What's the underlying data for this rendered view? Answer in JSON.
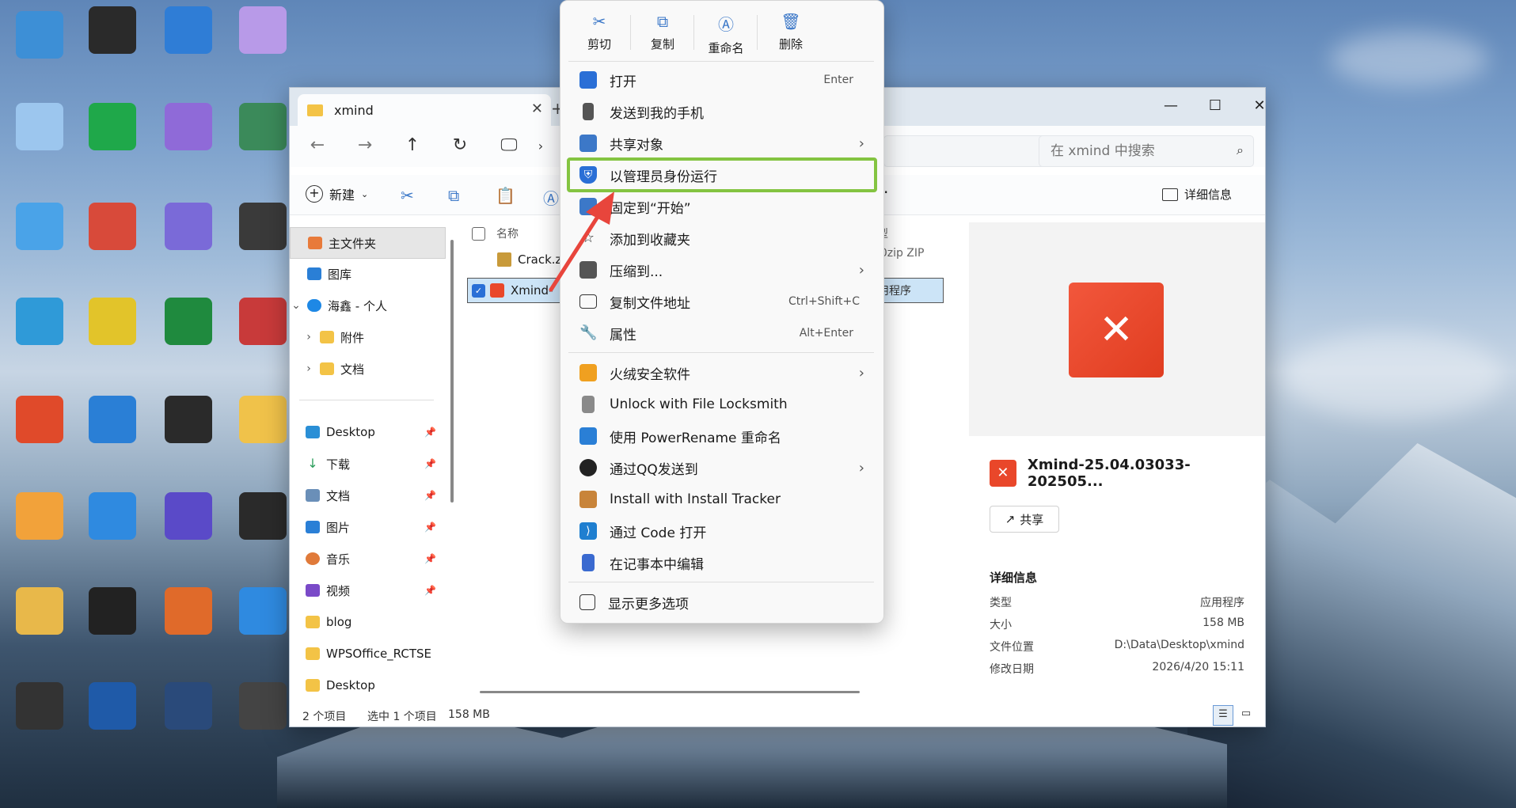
{
  "explorer": {
    "tab_title": "xmind",
    "search_placeholder": "在 xmind 中搜索",
    "toolbar": {
      "new_label": "新建",
      "details_label": "详细信息"
    },
    "sidebar": {
      "items": [
        {
          "label": "主文件夹",
          "icon": "home-icon"
        },
        {
          "label": "图库",
          "icon": "gallery-icon"
        },
        {
          "label": "海鑫 - 个人",
          "icon": "onedrive-icon"
        },
        {
          "label": "附件",
          "icon": "folder-icon"
        },
        {
          "label": "文档",
          "icon": "folder-icon"
        }
      ],
      "quick_access": [
        {
          "label": "Desktop",
          "icon": "desktop-icon"
        },
        {
          "label": "下载",
          "icon": "download-icon"
        },
        {
          "label": "文档",
          "icon": "documents-icon"
        },
        {
          "label": "图片",
          "icon": "pictures-icon"
        },
        {
          "label": "音乐",
          "icon": "music-icon"
        },
        {
          "label": "视频",
          "icon": "video-icon"
        },
        {
          "label": "blog",
          "icon": "folder-icon"
        },
        {
          "label": "WPSOffice_RCTSE",
          "icon": "folder-icon"
        },
        {
          "label": "Desktop",
          "icon": "folder-icon"
        }
      ]
    },
    "filelist": {
      "col_name": "名称",
      "col_type": "类型",
      "rows": [
        {
          "name": "Crack.zi",
          "type": "360zip ZIP file"
        },
        {
          "name": "Xmind-",
          "type": "应用程序"
        }
      ]
    },
    "details": {
      "file_name": "Xmind-25.04.03033-202505...",
      "share_label": "共享",
      "section": "详细信息",
      "props": [
        {
          "k": "类型",
          "v": "应用程序"
        },
        {
          "k": "大小",
          "v": "158 MB"
        },
        {
          "k": "文件位置",
          "v": "D:\\Data\\Desktop\\xmind"
        },
        {
          "k": "修改日期",
          "v": "2026/4/20 15:11"
        }
      ]
    },
    "status": {
      "count": "2 个项目",
      "selected": "选中 1 个项目",
      "size": "158 MB"
    }
  },
  "context_menu": {
    "quick": [
      {
        "label": "剪切",
        "icon": "cut-icon"
      },
      {
        "label": "复制",
        "icon": "copy-icon"
      },
      {
        "label": "重命名",
        "icon": "rename-icon"
      },
      {
        "label": "删除",
        "icon": "delete-icon"
      }
    ],
    "items": [
      {
        "label": "打开",
        "shortcut": "Enter"
      },
      {
        "label": "发送到我的手机",
        "shortcut": ""
      },
      {
        "label": "共享对象",
        "shortcut": ""
      },
      {
        "label": "以管理员身份运行",
        "shortcut": ""
      },
      {
        "label": "固定到“开始”",
        "shortcut": ""
      },
      {
        "label": "添加到收藏夹",
        "shortcut": ""
      },
      {
        "label": "压缩到...",
        "shortcut": ""
      },
      {
        "label": "复制文件地址",
        "shortcut": "Ctrl+Shift+C"
      },
      {
        "label": "属性",
        "shortcut": "Alt+Enter"
      },
      {
        "label": "火绒安全软件",
        "shortcut": ""
      },
      {
        "label": "Unlock with File Locksmith",
        "shortcut": ""
      },
      {
        "label": "使用 PowerRename 重命名",
        "shortcut": ""
      },
      {
        "label": "通过QQ发送到",
        "shortcut": ""
      },
      {
        "label": "Install with Install Tracker",
        "shortcut": ""
      },
      {
        "label": "通过 Code 打开",
        "shortcut": ""
      },
      {
        "label": "在记事本中编辑",
        "shortcut": ""
      },
      {
        "label": "显示更多选项",
        "shortcut": ""
      }
    ]
  },
  "colors": {
    "highlight_outline": "#84c441",
    "arrow": "#e8453c",
    "accent": "#2a6fd6"
  }
}
